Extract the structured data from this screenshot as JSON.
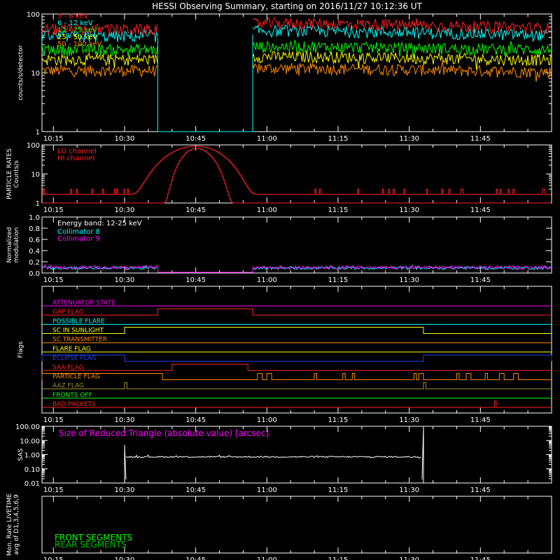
{
  "title": "HESSI Observing Summary, starting on 2016/11/27 10:12:36 UT",
  "time_ticks": [
    "10:15",
    "10:30",
    "10:45",
    "11:00",
    "11:15",
    "11:30",
    "11:45"
  ],
  "colors": {
    "background": "#000000",
    "axis": "#ffffff",
    "red": "#ff2020",
    "cyan": "#00ffff",
    "green": "#00ff00",
    "yellow": "#ffff00",
    "orange": "#ff8c00",
    "magenta": "#ff00ff",
    "blue": "#2040ff",
    "olive": "#a09030"
  },
  "chart_data": [
    {
      "type": "line",
      "ylabel": "counts/s/detector",
      "yscale": "log",
      "ylim": [
        1,
        100
      ],
      "y_ticks": [
        "1",
        "10",
        "100"
      ],
      "x_range": [
        "10:12:36",
        "12:00"
      ],
      "gap": [
        "10:37",
        "10:57"
      ],
      "series": [
        {
          "name": "3 - 6 keV",
          "color": "#ff2020",
          "level_before": 55,
          "level_after": 70,
          "level_end": 55
        },
        {
          "name": "6 - 12 keV",
          "color": "#00ffff",
          "level_before": 42,
          "level_after": 52,
          "level_end": 42
        },
        {
          "name": "12 - 25 keV",
          "color": "#00ff00",
          "level_before": 25,
          "level_after": 28,
          "level_end": 24
        },
        {
          "name": "25 - 50 keV",
          "color": "#ffff00",
          "level_before": 17,
          "level_after": 19,
          "level_end": 16
        },
        {
          "name": "50 - 100 keV",
          "color": "#ff8c00",
          "level_before": 11,
          "level_after": 12,
          "level_end": 10
        }
      ],
      "legend": [
        "3 - 6 keV",
        "6 - 12 keV",
        "12 - 25 keV",
        "25 - 50 keV",
        "50 - 100 keV"
      ]
    },
    {
      "type": "line",
      "ylabel_lines": [
        "PARTICLE RATES",
        "Counts/s"
      ],
      "yscale": "log",
      "ylim": [
        1,
        100
      ],
      "y_ticks": [
        "1",
        "10",
        "100"
      ],
      "legend": [
        "LO channel",
        "HI channel"
      ],
      "series": [
        {
          "name": "LO channel",
          "color": "#ff2020",
          "baseline": 2,
          "peak": 90,
          "rise": [
            "10:31",
            "10:45"
          ],
          "fall": [
            "10:45",
            "10:58"
          ]
        },
        {
          "name": "HI channel",
          "color": "#ff2030",
          "baseline": 1,
          "peak": 75,
          "rise": [
            "10:38",
            "10:45"
          ],
          "fall": [
            "10:45",
            "10:53"
          ]
        }
      ]
    },
    {
      "type": "line",
      "ylabel_lines": [
        "Normalized",
        "modulation"
      ],
      "ylim": [
        0,
        1
      ],
      "y_ticks": [
        "0.0",
        "0.2",
        "0.4",
        "0.6",
        "0.8",
        "1.0"
      ],
      "annotation": "Energy band: 12-25 keV",
      "legend": [
        "Collimator 8",
        "Collimator 9"
      ],
      "series": [
        {
          "name": "Collimator 8",
          "color": "#00ffff",
          "level": 0.09
        },
        {
          "name": "Collimator 9",
          "color": "#ff00ff",
          "level": 0.1
        }
      ],
      "gap": [
        "10:37",
        "10:57"
      ]
    },
    {
      "type": "step",
      "ylabel": "Flags",
      "flags": [
        {
          "name": "ATTENUATOR STATE",
          "color": "#ff00ff",
          "high": []
        },
        {
          "name": "GAP FLAG",
          "color": "#ff2020",
          "high": [
            [
              "10:37",
              "10:57"
            ]
          ]
        },
        {
          "name": "POSSIBLE FLARE",
          "color": "#00ffff",
          "high": []
        },
        {
          "name": "SC IN SUNLIGHT",
          "color": "#ffff00",
          "high": [
            [
              "10:30",
              "11:33"
            ]
          ]
        },
        {
          "name": "SC TRANSMITTER",
          "color": "#ff8c00",
          "high": []
        },
        {
          "name": "FLARE FLAG",
          "color": "#ffff00",
          "high": []
        },
        {
          "name": "ECLIPSE FLAG",
          "color": "#2040ff",
          "high": [
            [
              "10:12:36",
              "10:30"
            ],
            [
              "11:33",
              "12:00"
            ]
          ]
        },
        {
          "name": "SAA FLAG",
          "color": "#ff2020",
          "high": [
            [
              "10:40",
              "10:56"
            ]
          ]
        },
        {
          "name": "PARTICLE FLAG",
          "color": "#ff8c00",
          "high": [
            [
              "10:12:36",
              "10:38"
            ],
            [
              "10:58",
              "10:59"
            ],
            [
              "11:00",
              "11:01"
            ],
            [
              "11:10",
              "11:10:30"
            ],
            [
              "11:16",
              "11:16:30"
            ],
            [
              "11:18",
              "11:18:30"
            ],
            [
              "11:31",
              "11:31:30"
            ],
            [
              "11:32",
              "11:33"
            ],
            [
              "11:40",
              "11:40:30"
            ],
            [
              "11:42",
              "11:43"
            ],
            [
              "11:46",
              "11:46:30"
            ],
            [
              "11:49",
              "11:50"
            ],
            [
              "11:52",
              "11:53"
            ]
          ]
        },
        {
          "name": "AAZ FLAG",
          "color": "#a09030",
          "high": [
            [
              "10:30",
              "10:30:30"
            ],
            [
              "11:33",
              "11:33:30"
            ]
          ]
        },
        {
          "name": "FRONTS OFF",
          "color": "#00ff00",
          "high": []
        },
        {
          "name": "BAD PACKETS",
          "color": "#ff2020",
          "high": [
            [
              "11:48",
              "11:48:20"
            ]
          ]
        }
      ]
    },
    {
      "type": "line",
      "ylabel": "SAS",
      "yscale": "log",
      "ylim": [
        0.01,
        100
      ],
      "y_ticks": [
        "0.01",
        "0.10",
        "1.00",
        "10.00",
        "100.00"
      ],
      "annotation": "Size of Reduced Triangle (absolute value) [arcsec]",
      "series": [
        {
          "name": "",
          "color": "#ffffff",
          "level": 0.7,
          "start": "10:30",
          "end": "11:33"
        }
      ]
    },
    {
      "type": "line",
      "ylabel_lines": [
        "Mon. Rate LIVETIME",
        "avg of D1,3,4,5,6,9"
      ],
      "legend": [
        "FRONT SEGMENTS",
        "REAR SEGMENTS"
      ],
      "legend_colors": [
        "#00ff00",
        "#00c000"
      ],
      "series": []
    }
  ]
}
